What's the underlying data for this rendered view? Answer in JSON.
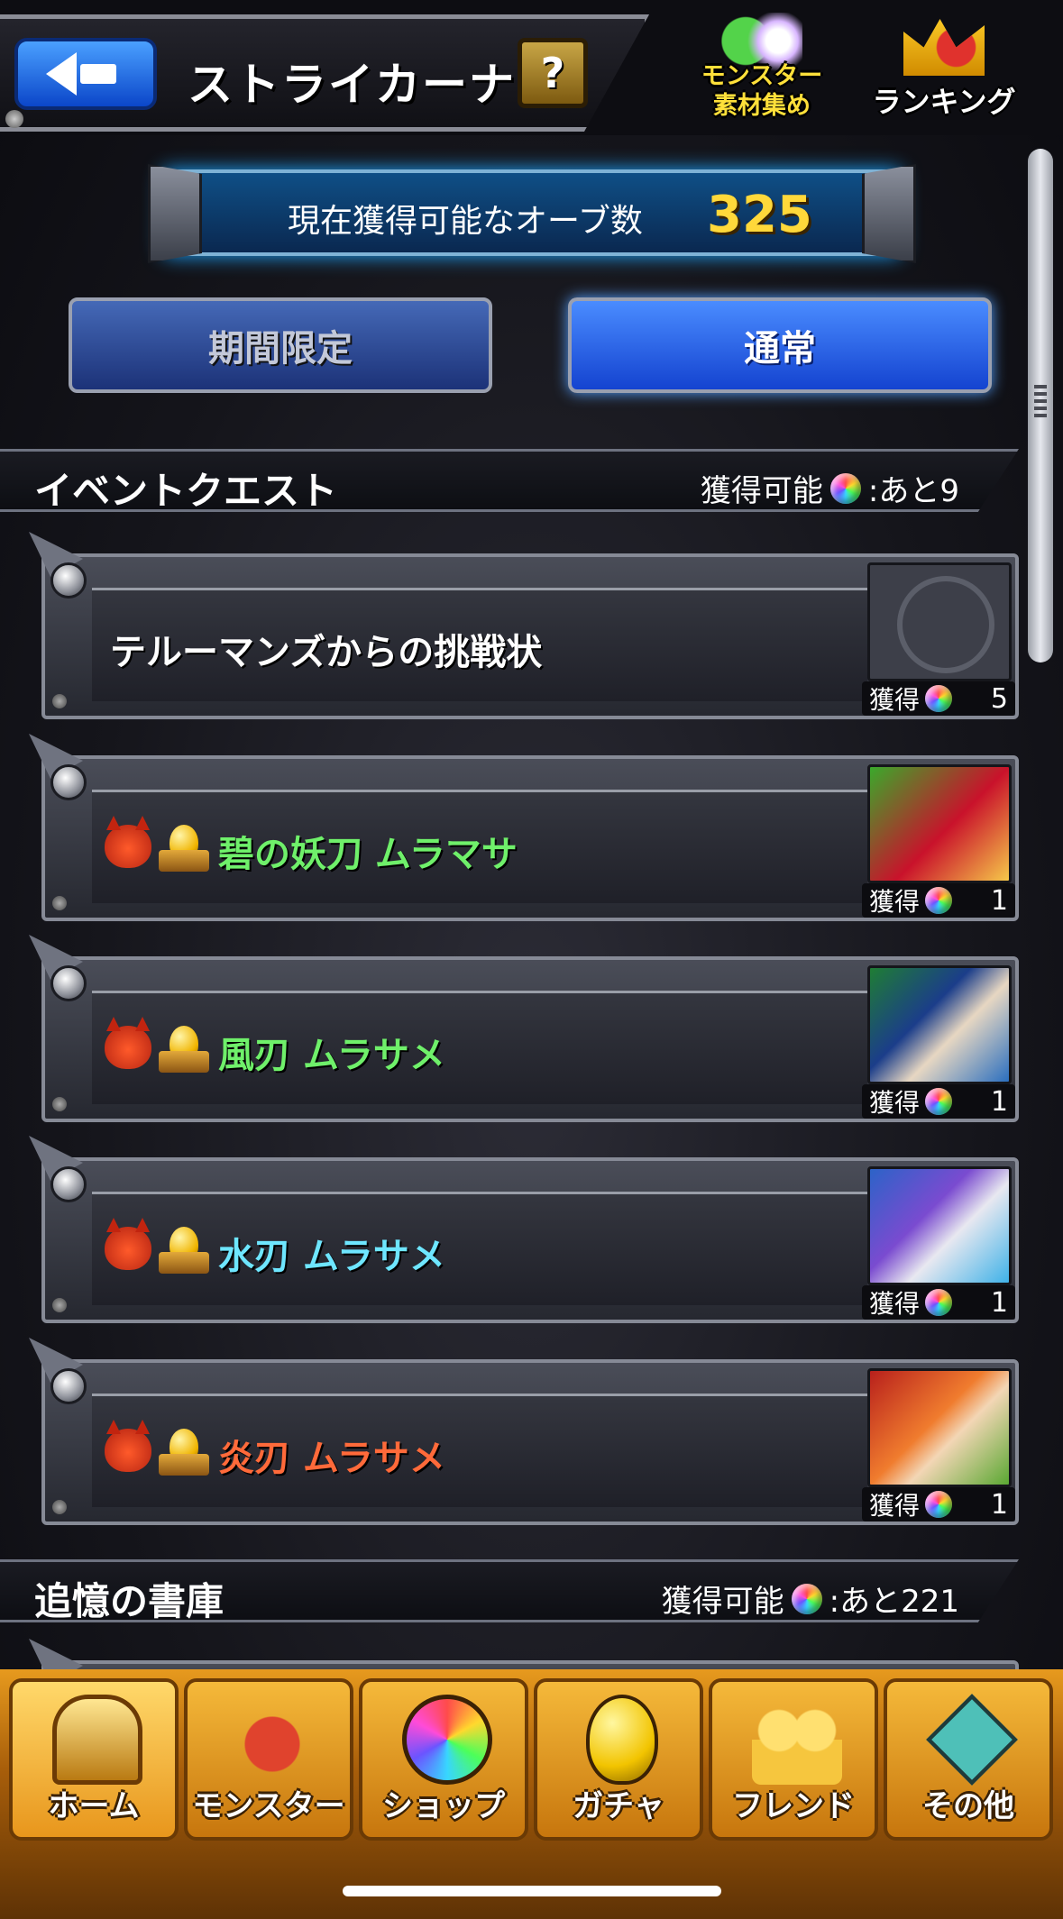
{
  "header": {
    "title": "ストライカーナビ",
    "help_label": "?",
    "material_label_line1": "モンスター",
    "material_label_line2": "素材集め",
    "ranking_label": "ランキング"
  },
  "orb_counter": {
    "label": "現在獲得可能なオーブ数",
    "value": "325"
  },
  "tabs": [
    {
      "label": "期間限定",
      "active": false
    },
    {
      "label": "通常",
      "active": true
    }
  ],
  "sections": [
    {
      "title": "イベントクエスト",
      "remaining_prefix": "獲得可能",
      "remaining_suffix": ":あと9"
    },
    {
      "title": "追憶の書庫",
      "remaining_prefix": "獲得可能",
      "remaining_suffix": ":あと221"
    }
  ],
  "quests": [
    {
      "name": "テルーマンズからの挑戦状",
      "obtain_label": "獲得",
      "count": "5",
      "color": "#ffffff"
    },
    {
      "name": "碧の妖刀 ムラマサ",
      "obtain_label": "獲得",
      "count": "1",
      "color": "#6ff06a"
    },
    {
      "name": "風刃 ムラサメ",
      "obtain_label": "獲得",
      "count": "1",
      "color": "#6ff06a"
    },
    {
      "name": "水刃 ムラサメ",
      "obtain_label": "獲得",
      "count": "1",
      "color": "#6ee6ff"
    },
    {
      "name": "炎刃 ムラサメ",
      "obtain_label": "獲得",
      "count": "1",
      "color": "#ff6a3a"
    }
  ],
  "bottom_nav": [
    {
      "label": "ホーム",
      "icon": "home-icon",
      "active": true
    },
    {
      "label": "モンスター",
      "icon": "monster-icon",
      "active": false
    },
    {
      "label": "ショップ",
      "icon": "orb-icon",
      "active": false
    },
    {
      "label": "ガチャ",
      "icon": "egg-icon",
      "active": false
    },
    {
      "label": "フレンド",
      "icon": "friends-icon",
      "active": false
    },
    {
      "label": "その他",
      "icon": "other-icon",
      "active": false
    }
  ]
}
